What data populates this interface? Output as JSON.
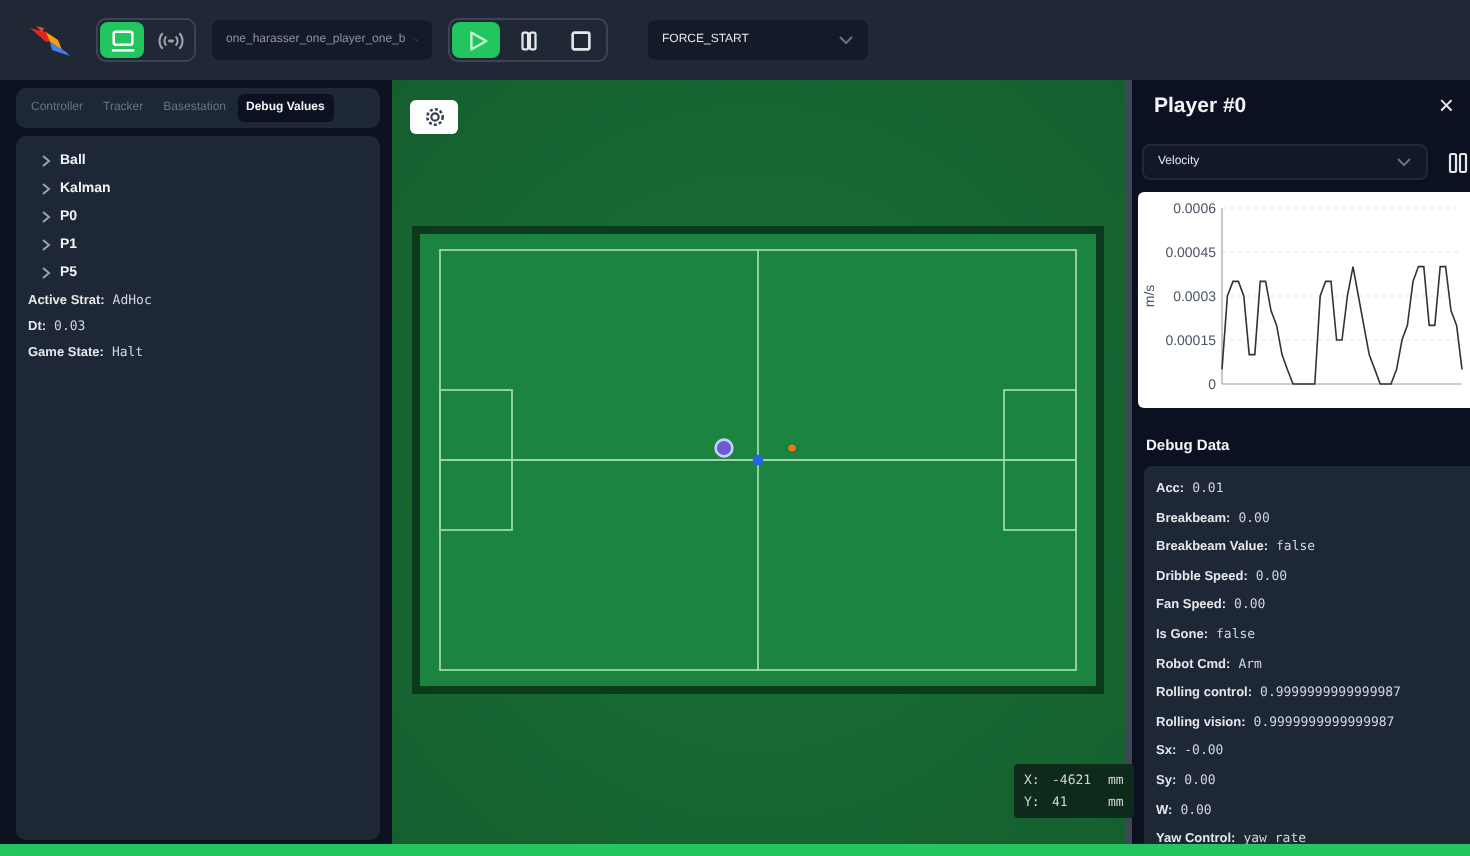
{
  "toolbar": {
    "view_toggle": [
      {
        "kind": "monitor",
        "selected": true
      },
      {
        "kind": "broadcast",
        "selected": false
      }
    ],
    "strategy_select": {
      "value": "one_harasser_one_player_one_b"
    },
    "playback": [
      {
        "kind": "play",
        "selected": true
      },
      {
        "kind": "pause",
        "selected": false
      },
      {
        "kind": "stop",
        "selected": false
      }
    ],
    "command_select": {
      "value": "FORCE_START"
    }
  },
  "left_panel": {
    "tabs": [
      {
        "label": "Controller",
        "selected": false
      },
      {
        "label": "Tracker",
        "selected": false
      },
      {
        "label": "Basestation",
        "selected": false
      },
      {
        "label": "Debug Values",
        "selected": true
      }
    ],
    "tree": [
      {
        "label": "Ball",
        "expanded": false
      },
      {
        "label": "Kalman",
        "expanded": false
      },
      {
        "label": "P0",
        "expanded": false
      },
      {
        "label": "P1",
        "expanded": false
      },
      {
        "label": "P5",
        "expanded": false
      }
    ],
    "values": [
      {
        "key": "Active Strat:",
        "value": "AdHoc"
      },
      {
        "key": "Dt:",
        "value": "0.03"
      },
      {
        "key": "Game State:",
        "value": "Halt"
      }
    ]
  },
  "field": {
    "cursor": {
      "x_label": "X:",
      "x_value": "-4621",
      "x_unit": "mm",
      "y_label": "Y:",
      "y_value": "41",
      "y_unit": "mm"
    }
  },
  "right_panel": {
    "title": "Player #0",
    "close": "×",
    "metric_select": {
      "value": "Velocity"
    },
    "chart_data": {
      "type": "line",
      "grid": true,
      "ylabel": "m/s",
      "ylim": [
        0,
        0.0006
      ],
      "yticks": [
        {
          "value": 0,
          "label": "0"
        },
        {
          "value": 0.00015,
          "label": "0.00015"
        },
        {
          "value": 0.0003,
          "label": "0.0003"
        },
        {
          "value": 0.00045,
          "label": "0.00045"
        },
        {
          "value": 0.0006,
          "label": "0.0006"
        }
      ],
      "values": [
        5e-05,
        0.0003,
        0.00035,
        0.00035,
        0.0003,
        0.0001,
        0.0001,
        0.00035,
        0.00035,
        0.00025,
        0.0002,
        0.0001,
        5e-05,
        0,
        0,
        0,
        0,
        0,
        0.0003,
        0.00035,
        0.00035,
        0.00015,
        0.00015,
        0.0003,
        0.0004,
        0.0003,
        0.0002,
        0.0001,
        5e-05,
        0,
        0,
        0,
        5e-05,
        0.00015,
        0.0002,
        0.00035,
        0.0004,
        0.0004,
        0.0002,
        0.0002,
        0.0004,
        0.0004,
        0.00025,
        0.0002,
        5e-05
      ]
    },
    "debug_title": "Debug Data",
    "debug": [
      {
        "key": "Acc:",
        "value": "0.01"
      },
      {
        "key": "Breakbeam:",
        "value": "0.00"
      },
      {
        "key": "Breakbeam Value:",
        "value": "false"
      },
      {
        "key": "Dribble Speed:",
        "value": "0.00"
      },
      {
        "key": "Fan Speed:",
        "value": "0.00"
      },
      {
        "key": "Is Gone:",
        "value": "false"
      },
      {
        "key": "Robot Cmd:",
        "value": "Arm"
      },
      {
        "key": "Rolling control:",
        "value": "0.9999999999999987"
      },
      {
        "key": "Rolling vision:",
        "value": "0.9999999999999987"
      },
      {
        "key": "Sx:",
        "value": "-0.00"
      },
      {
        "key": "Sy:",
        "value": "0.00"
      },
      {
        "key": "W:",
        "value": "0.00"
      },
      {
        "key": "Yaw Control:",
        "value": "yaw rate"
      }
    ]
  }
}
